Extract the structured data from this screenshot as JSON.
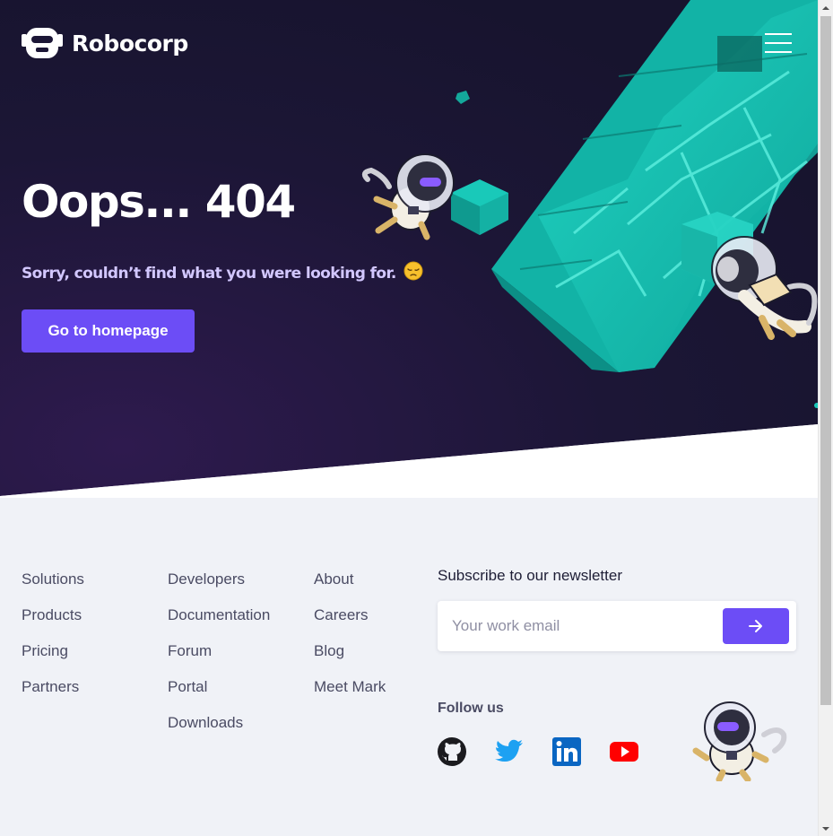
{
  "header": {
    "logo_text": "Robocorp",
    "menu_icon": "hamburger-menu-icon"
  },
  "hero": {
    "title": "Oops... 404",
    "subtitle": "Sorry, couldn’t find what you were looking for.",
    "subtitle_emoji": "😔",
    "button_label": "Go to homepage"
  },
  "footer": {
    "columns": [
      {
        "links": [
          "Solutions",
          "Products",
          "Pricing",
          "Partners"
        ]
      },
      {
        "links": [
          "Developers",
          "Documentation",
          "Forum",
          "Portal",
          "Downloads"
        ]
      },
      {
        "links": [
          "About",
          "Careers",
          "Blog",
          "Meet Mark"
        ]
      }
    ],
    "newsletter": {
      "title": "Subscribe to our newsletter",
      "placeholder": "Your work email",
      "submit_icon": "arrow-right-icon"
    },
    "follow": {
      "title": "Follow us",
      "icons": [
        "github-icon",
        "twitter-icon",
        "linkedin-icon",
        "youtube-icon"
      ]
    }
  },
  "colors": {
    "hero_bg": "#1c1636",
    "accent": "#6c4df6",
    "teal": "#19c9b9",
    "footer_bg": "#f0f2f7",
    "subtitle": "#d2c7ff"
  }
}
